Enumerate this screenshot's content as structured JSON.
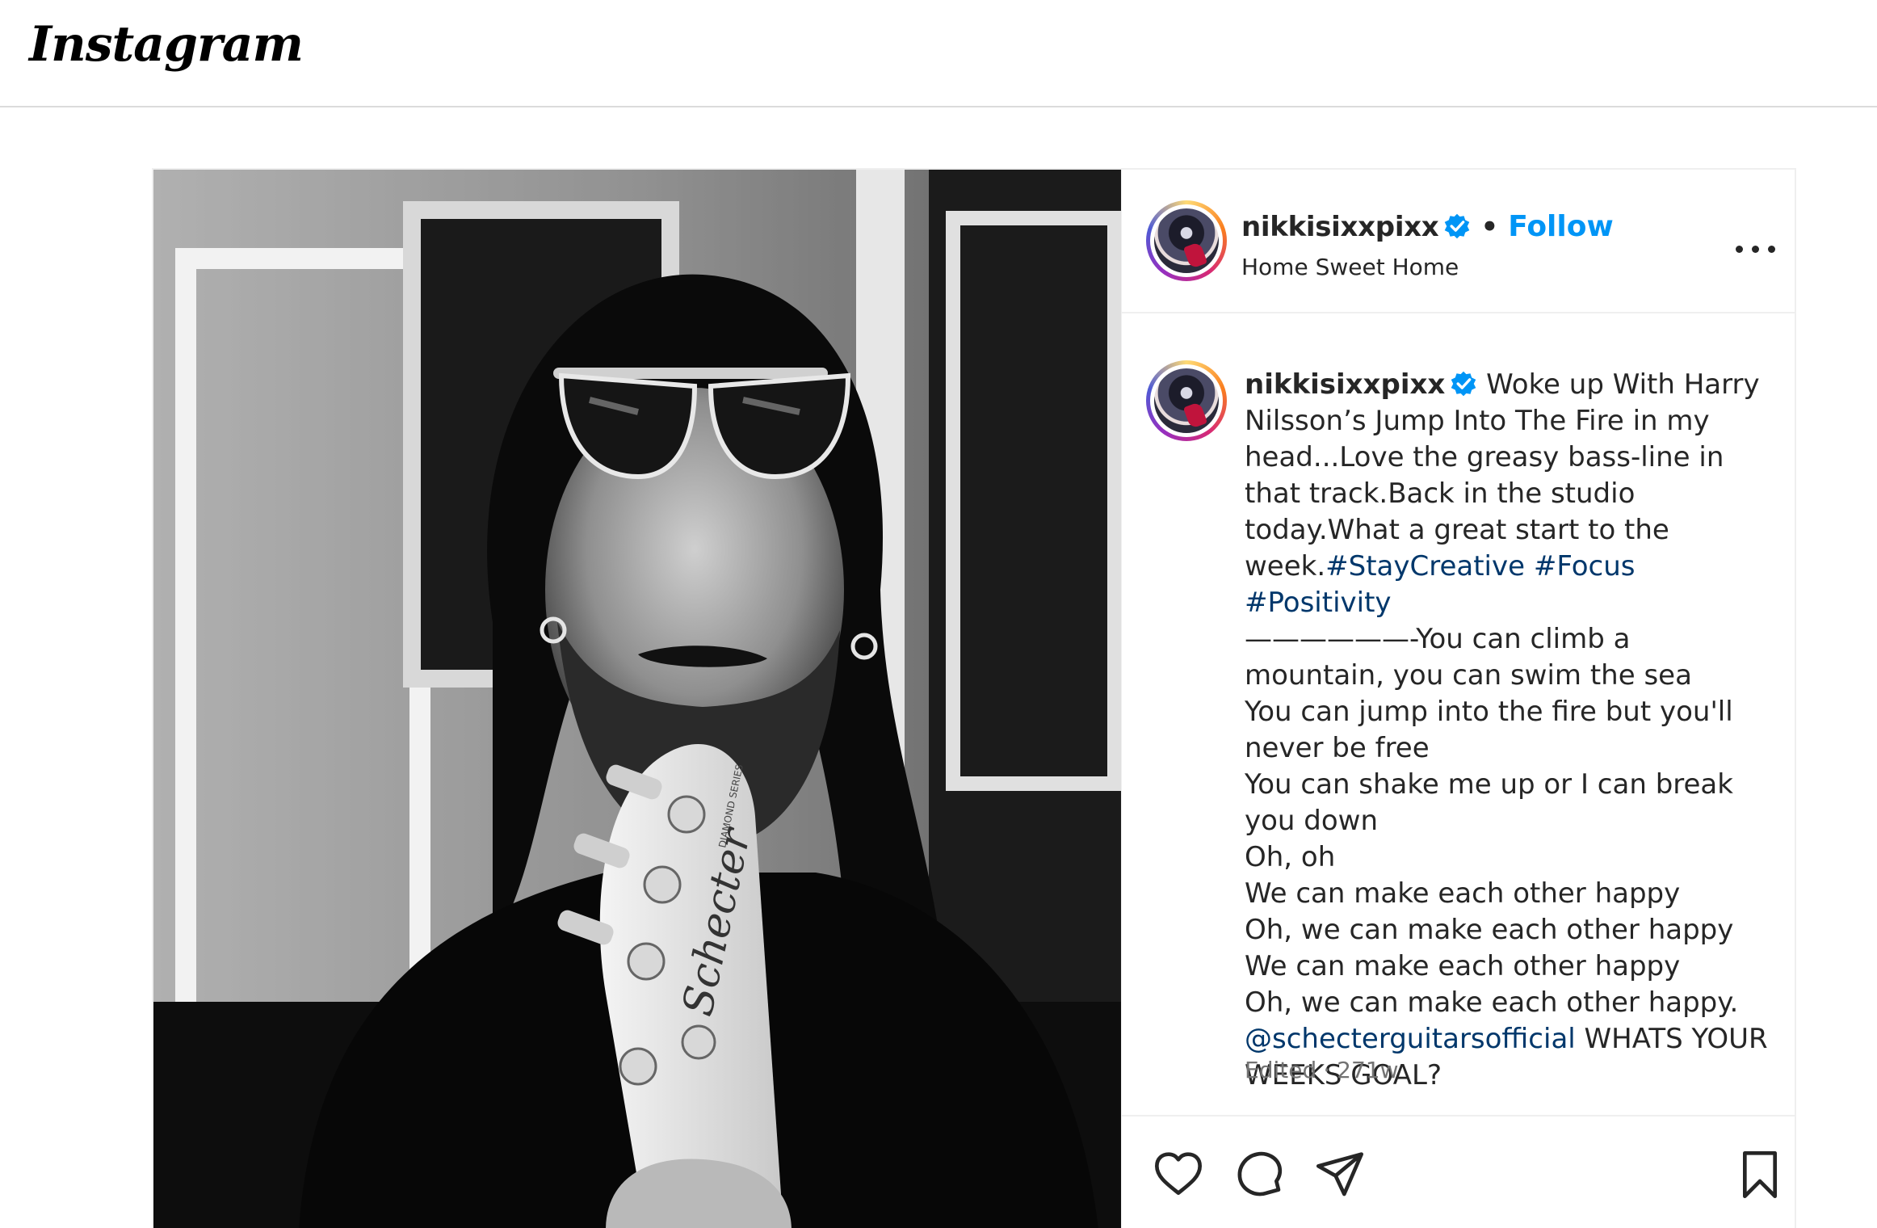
{
  "app": {
    "logo_text": "Instagram"
  },
  "post": {
    "author": {
      "username": "nikkisixxpixx",
      "verified": true,
      "follow_label": "Follow",
      "separator": "•",
      "location": "Home Sweet Home"
    },
    "caption": {
      "username": "nikkisixxpixx",
      "intro": " Woke up With Harry Nilsson’s Jump Into The Fire in my head...Love the greasy bass-line in that track.Back in the studio today.What a great start to the week.",
      "hashtags": [
        "#StayCreative",
        "#Focus",
        "#Positivity"
      ],
      "lines": [
        "——————-You can climb a mountain, you can swim the sea",
        "You can jump into the fire but you'll never be free",
        "You can shake me up or I can break you down",
        "Oh, oh",
        "We can make each other happy",
        "Oh, we can make each other happy",
        "We can make each other happy",
        "Oh, we can make each other happy."
      ],
      "mention": "@schecterguitarsofficial",
      "outro": " WHATS YOUR WEEKS GOAL?"
    },
    "meta": {
      "edited": "Edited",
      "dot": "·",
      "age": "271w"
    },
    "image": {
      "guitar_brand": "Schecter",
      "guitar_series": "DIAMOND SERIES"
    },
    "actions": {
      "like_icon": "heart-icon",
      "comment_icon": "comment-icon",
      "share_icon": "paper-plane-icon",
      "save_icon": "bookmark-icon"
    },
    "colors": {
      "follow": "#0095f6",
      "verified": "#0095f6",
      "hashtag": "#00376b",
      "meta": "#737373",
      "border": "#efefef"
    }
  }
}
